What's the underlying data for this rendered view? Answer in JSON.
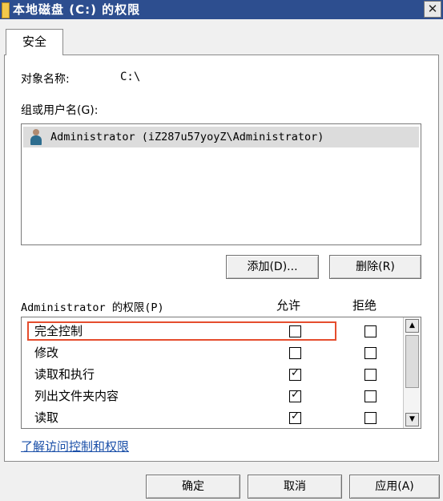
{
  "window": {
    "title": "本地磁盘 (C:) 的权限",
    "close_label": "✕"
  },
  "tabs": [
    {
      "label": "安全"
    }
  ],
  "object": {
    "label": "对象名称:",
    "value": "C:\\"
  },
  "group_users": {
    "label": "组或用户名(G):",
    "items": [
      {
        "name": "Administrator (iZ287u57yoyZ\\Administrator)"
      }
    ]
  },
  "user_buttons": {
    "add": "添加(D)...",
    "remove": "删除(R)"
  },
  "permissions": {
    "header": "Administrator 的权限(P)",
    "col_allow": "允许",
    "col_deny": "拒绝",
    "rows": [
      {
        "name": "完全控制",
        "allow": false,
        "deny": false
      },
      {
        "name": "修改",
        "allow": false,
        "deny": false
      },
      {
        "name": "读取和执行",
        "allow": true,
        "deny": false
      },
      {
        "name": "列出文件夹内容",
        "allow": true,
        "deny": false
      },
      {
        "name": "读取",
        "allow": true,
        "deny": false
      }
    ]
  },
  "link": "了解访问控制和权限",
  "footer": {
    "ok": "确定",
    "cancel": "取消",
    "apply": "应用(A)"
  },
  "check_glyph": "✓",
  "colors": {
    "titlebar": "#2d4e8f",
    "highlight": "#e54d2e",
    "link": "#1a4fa8"
  }
}
